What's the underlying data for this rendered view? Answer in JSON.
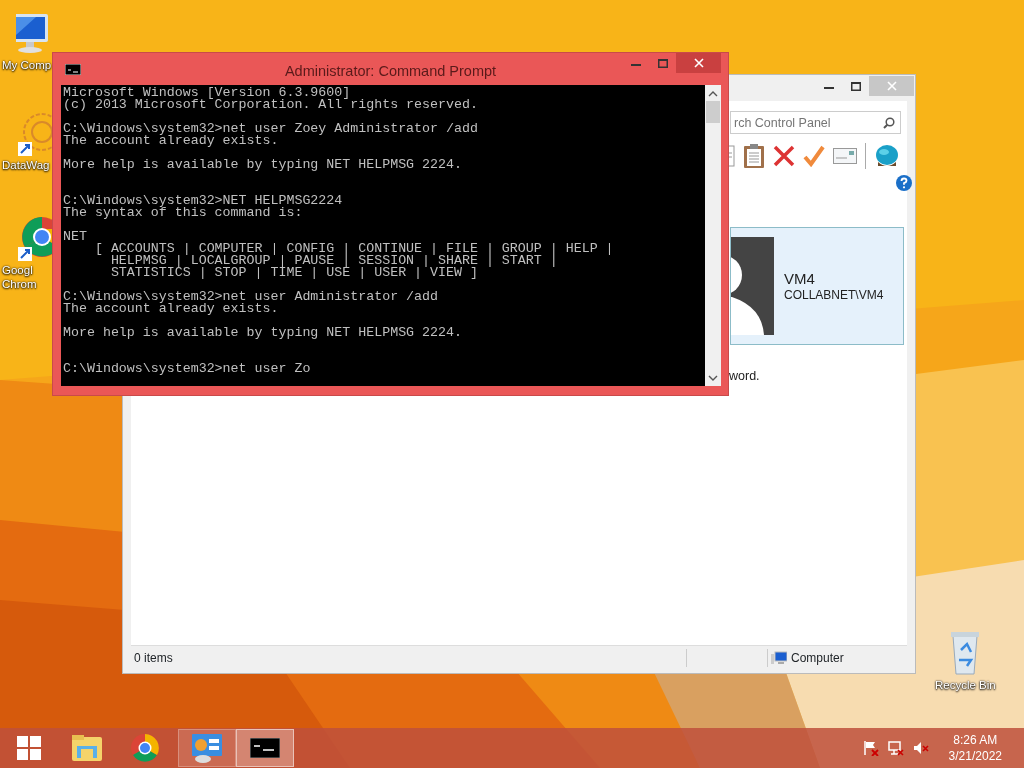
{
  "desktop_icons": [
    {
      "kind": "computer",
      "lines": [
        "My Comp"
      ]
    },
    {
      "kind": "datawag",
      "lines": [
        "DataWag"
      ]
    },
    {
      "kind": "chrome",
      "lines": [
        "Googl",
        "Chrom"
      ]
    },
    {
      "kind": "recycle",
      "lines": [
        "Recycle Bin"
      ]
    }
  ],
  "control_panel": {
    "search": {
      "placeholder": "rch Control Panel"
    },
    "user": {
      "name": "VM4",
      "account": "COLLABNET\\VM4"
    },
    "body_text": "word.",
    "status_bar": {
      "items": "0 items",
      "location": "Computer"
    }
  },
  "command_prompt": {
    "title": "Administrator: Command Prompt",
    "output": "Microsoft Windows [Version 6.3.9600]\n(c) 2013 Microsoft Corporation. All rights reserved.\n\nC:\\Windows\\system32>net user Zoey Administrator /add\nThe account already exists.\n\nMore help is available by typing NET HELPMSG 2224.\n\n\nC:\\Windows\\system32>NET HELPMSG2224\nThe syntax of this command is:\n\nNET\n    [ ACCOUNTS | COMPUTER | CONFIG | CONTINUE | FILE | GROUP | HELP |\n      HELPMSG | LOCALGROUP | PAUSE | SESSION | SHARE | START |\n      STATISTICS | STOP | TIME | USE | USER | VIEW ]\n\nC:\\Windows\\system32>net user Administrator /add\nThe account already exists.\n\nMore help is available by typing NET HELPMSG 2224.\n\n\nC:\\Windows\\system32>net user Zo"
  },
  "taskbar": {
    "items": [
      {
        "kind": "start",
        "open": false,
        "selected": false
      },
      {
        "kind": "explorer",
        "open": false,
        "selected": false
      },
      {
        "kind": "chrome",
        "open": false,
        "selected": false
      },
      {
        "kind": "control-panel",
        "open": true,
        "selected": false
      },
      {
        "kind": "cmd",
        "open": true,
        "selected": true
      }
    ],
    "clock": {
      "time": "8:26 AM",
      "date": "3/21/2022"
    }
  }
}
